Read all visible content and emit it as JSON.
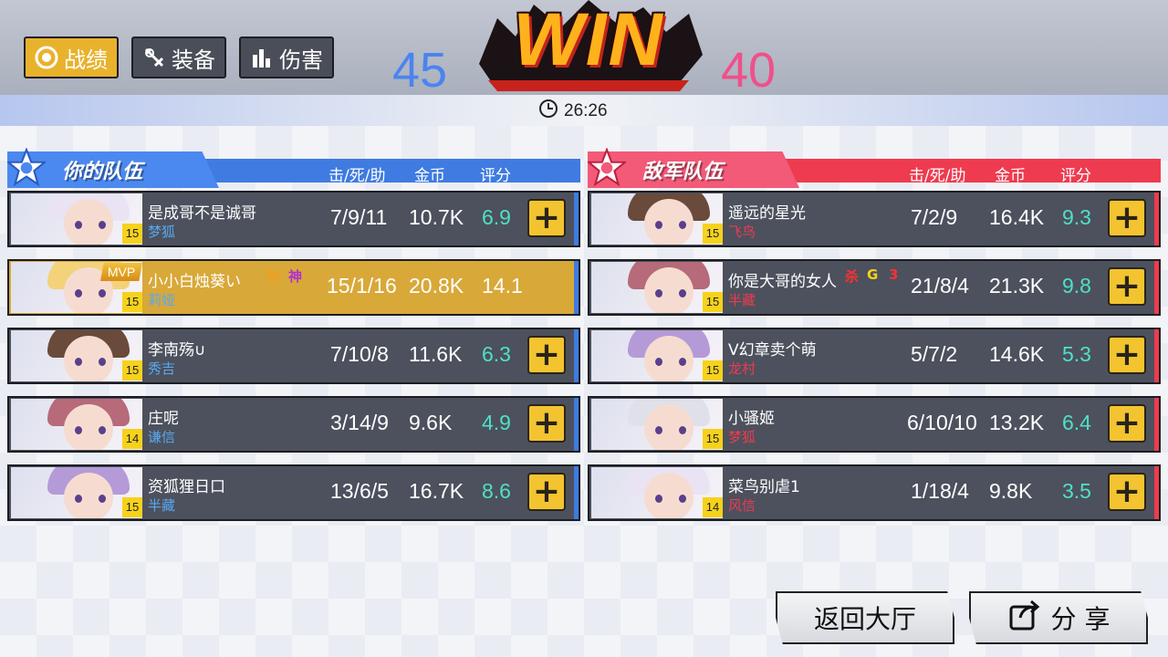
{
  "tabs": [
    {
      "label": "战绩",
      "icon": "target-icon",
      "active": true
    },
    {
      "label": "装备",
      "icon": "equipment-icon",
      "active": false
    },
    {
      "label": "伤害",
      "icon": "bar-chart-icon",
      "active": false
    }
  ],
  "score": {
    "blue": "45",
    "red": "40",
    "result": "WIN"
  },
  "timer": "26:26",
  "columns": {
    "kda": "击/死/助",
    "gold": "金币",
    "rating": "评分"
  },
  "teams": {
    "ally": {
      "title": "你的队伍",
      "players": [
        {
          "name": "是成哥不是诚哥",
          "hero": "梦狐",
          "level": "15",
          "kda": "7/9/11",
          "gold": "10.7K",
          "rating": "6.9"
        },
        {
          "name": "小小白烛葵い",
          "hero": "莉娅",
          "level": "15",
          "kda": "15/1/16",
          "gold": "20.8K",
          "rating": "14.1",
          "mvp": "MVP",
          "badges": [
            "助",
            "神"
          ]
        },
        {
          "name": "李南殇∪",
          "hero": "秀吉",
          "level": "15",
          "kda": "7/10/8",
          "gold": "11.6K",
          "rating": "6.3"
        },
        {
          "name": "庄呢",
          "hero": "谦信",
          "level": "14",
          "kda": "3/14/9",
          "gold": "9.6K",
          "rating": "4.9"
        },
        {
          "name": "资狐狸日口",
          "hero": "半藏",
          "level": "15",
          "kda": "13/6/5",
          "gold": "16.7K",
          "rating": "8.6"
        }
      ]
    },
    "enemy": {
      "title": "敌军队伍",
      "players": [
        {
          "name": "遥远的星光",
          "hero": "飞鸟",
          "level": "15",
          "kda": "7/2/9",
          "gold": "16.4K",
          "rating": "9.3"
        },
        {
          "name": "你是大哥的女人",
          "hero": "半藏",
          "level": "15",
          "kda": "21/8/4",
          "gold": "21.3K",
          "rating": "9.8",
          "badges": [
            "杀",
            "G",
            "3"
          ]
        },
        {
          "name": "V幻章卖个萌",
          "hero": "龙村",
          "level": "15",
          "kda": "5/7/2",
          "gold": "14.6K",
          "rating": "5.3"
        },
        {
          "name": "小骚姬",
          "hero": "梦狐",
          "level": "15",
          "kda": "6/10/10",
          "gold": "13.2K",
          "rating": "6.4"
        },
        {
          "name": "菜鸟别虐1",
          "hero": "风信",
          "level": "14",
          "kda": "1/18/4",
          "gold": "9.8K",
          "rating": "3.5"
        }
      ]
    }
  },
  "buttons": {
    "back": "返回大厅",
    "share": "分 享"
  },
  "colors": {
    "ally": "#3f7be0",
    "enemy": "#ee3b4f",
    "mvp": "#d8a838",
    "rating": "#4fe0c8",
    "hero_ally": "#5aa8f0",
    "hero_enemy": "#ee3b4f"
  }
}
